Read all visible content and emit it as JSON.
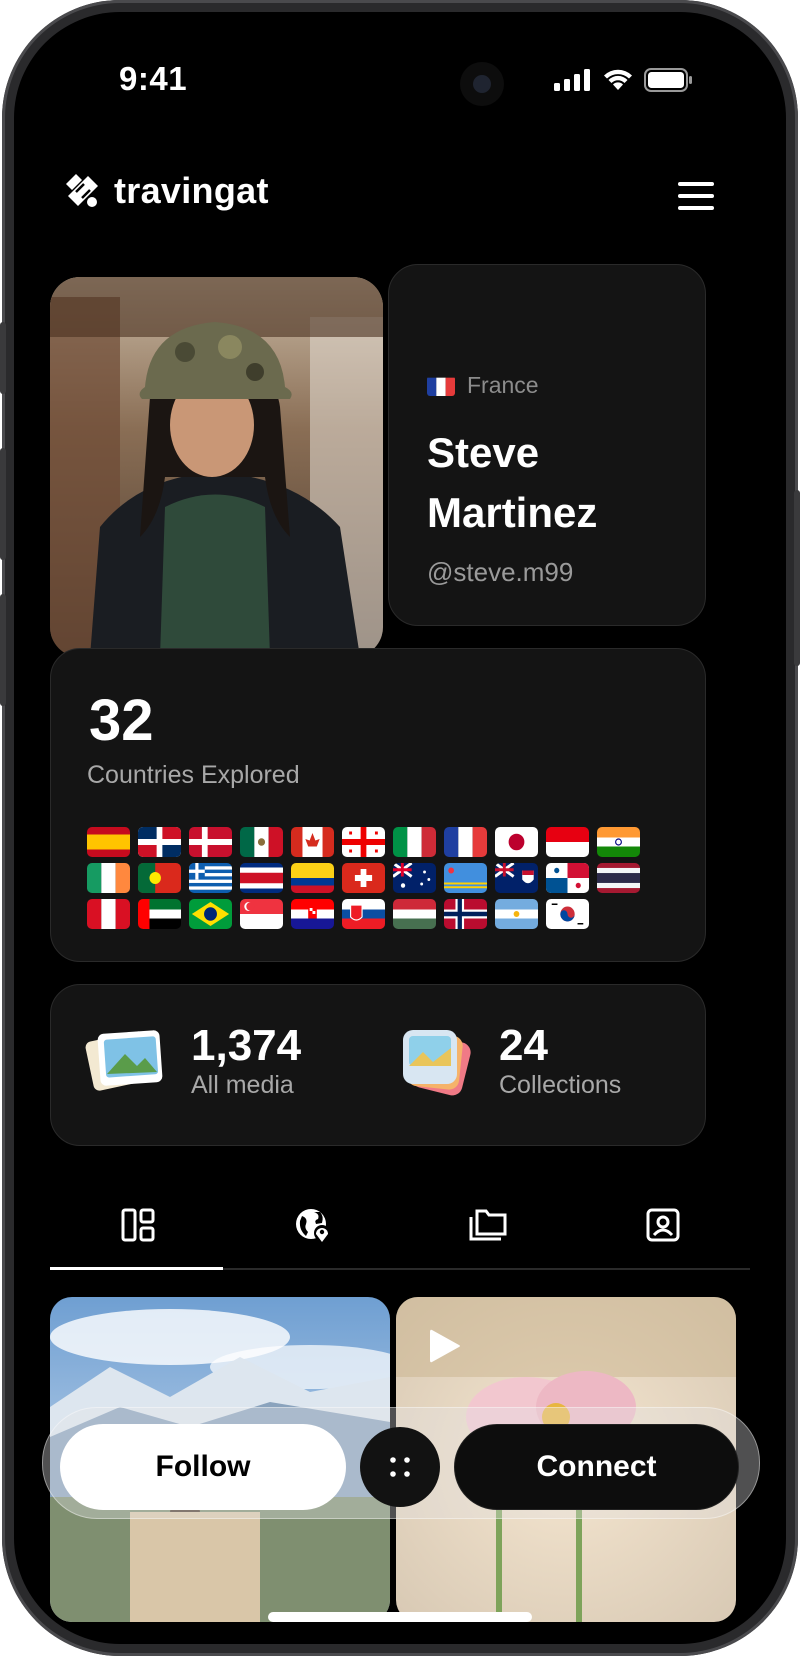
{
  "status_bar": {
    "time": "9:41"
  },
  "header": {
    "logo_text": "travingat"
  },
  "profile": {
    "country": "France",
    "name": "Steve Martinez",
    "handle": "@steve.m99"
  },
  "countries": {
    "count": "32",
    "label": "Countries Explored",
    "flags": [
      "Spain",
      "Dominican Republic",
      "Denmark",
      "Mexico",
      "Canada",
      "Georgia",
      "Italy",
      "France",
      "Japan",
      "Indonesia",
      "India",
      "Ireland",
      "Portugal",
      "Greece",
      "Costa Rica",
      "Colombia",
      "Switzerland",
      "Australia",
      "Aruba",
      "Cayman Islands",
      "Panama",
      "Thailand",
      "Peru",
      "UAE",
      "Brazil",
      "Singapore",
      "Croatia",
      "Slovakia",
      "Hungary",
      "Norway",
      "Argentina",
      "South Korea"
    ]
  },
  "stats": {
    "media_count": "1,374",
    "media_label": "All media",
    "collections_count": "24",
    "collections_label": "Collections"
  },
  "tabs": [
    "dashboard-icon",
    "globe-pin-icon",
    "folder-icon",
    "profile-card-icon"
  ],
  "actions": {
    "follow": "Follow",
    "connect": "Connect"
  }
}
